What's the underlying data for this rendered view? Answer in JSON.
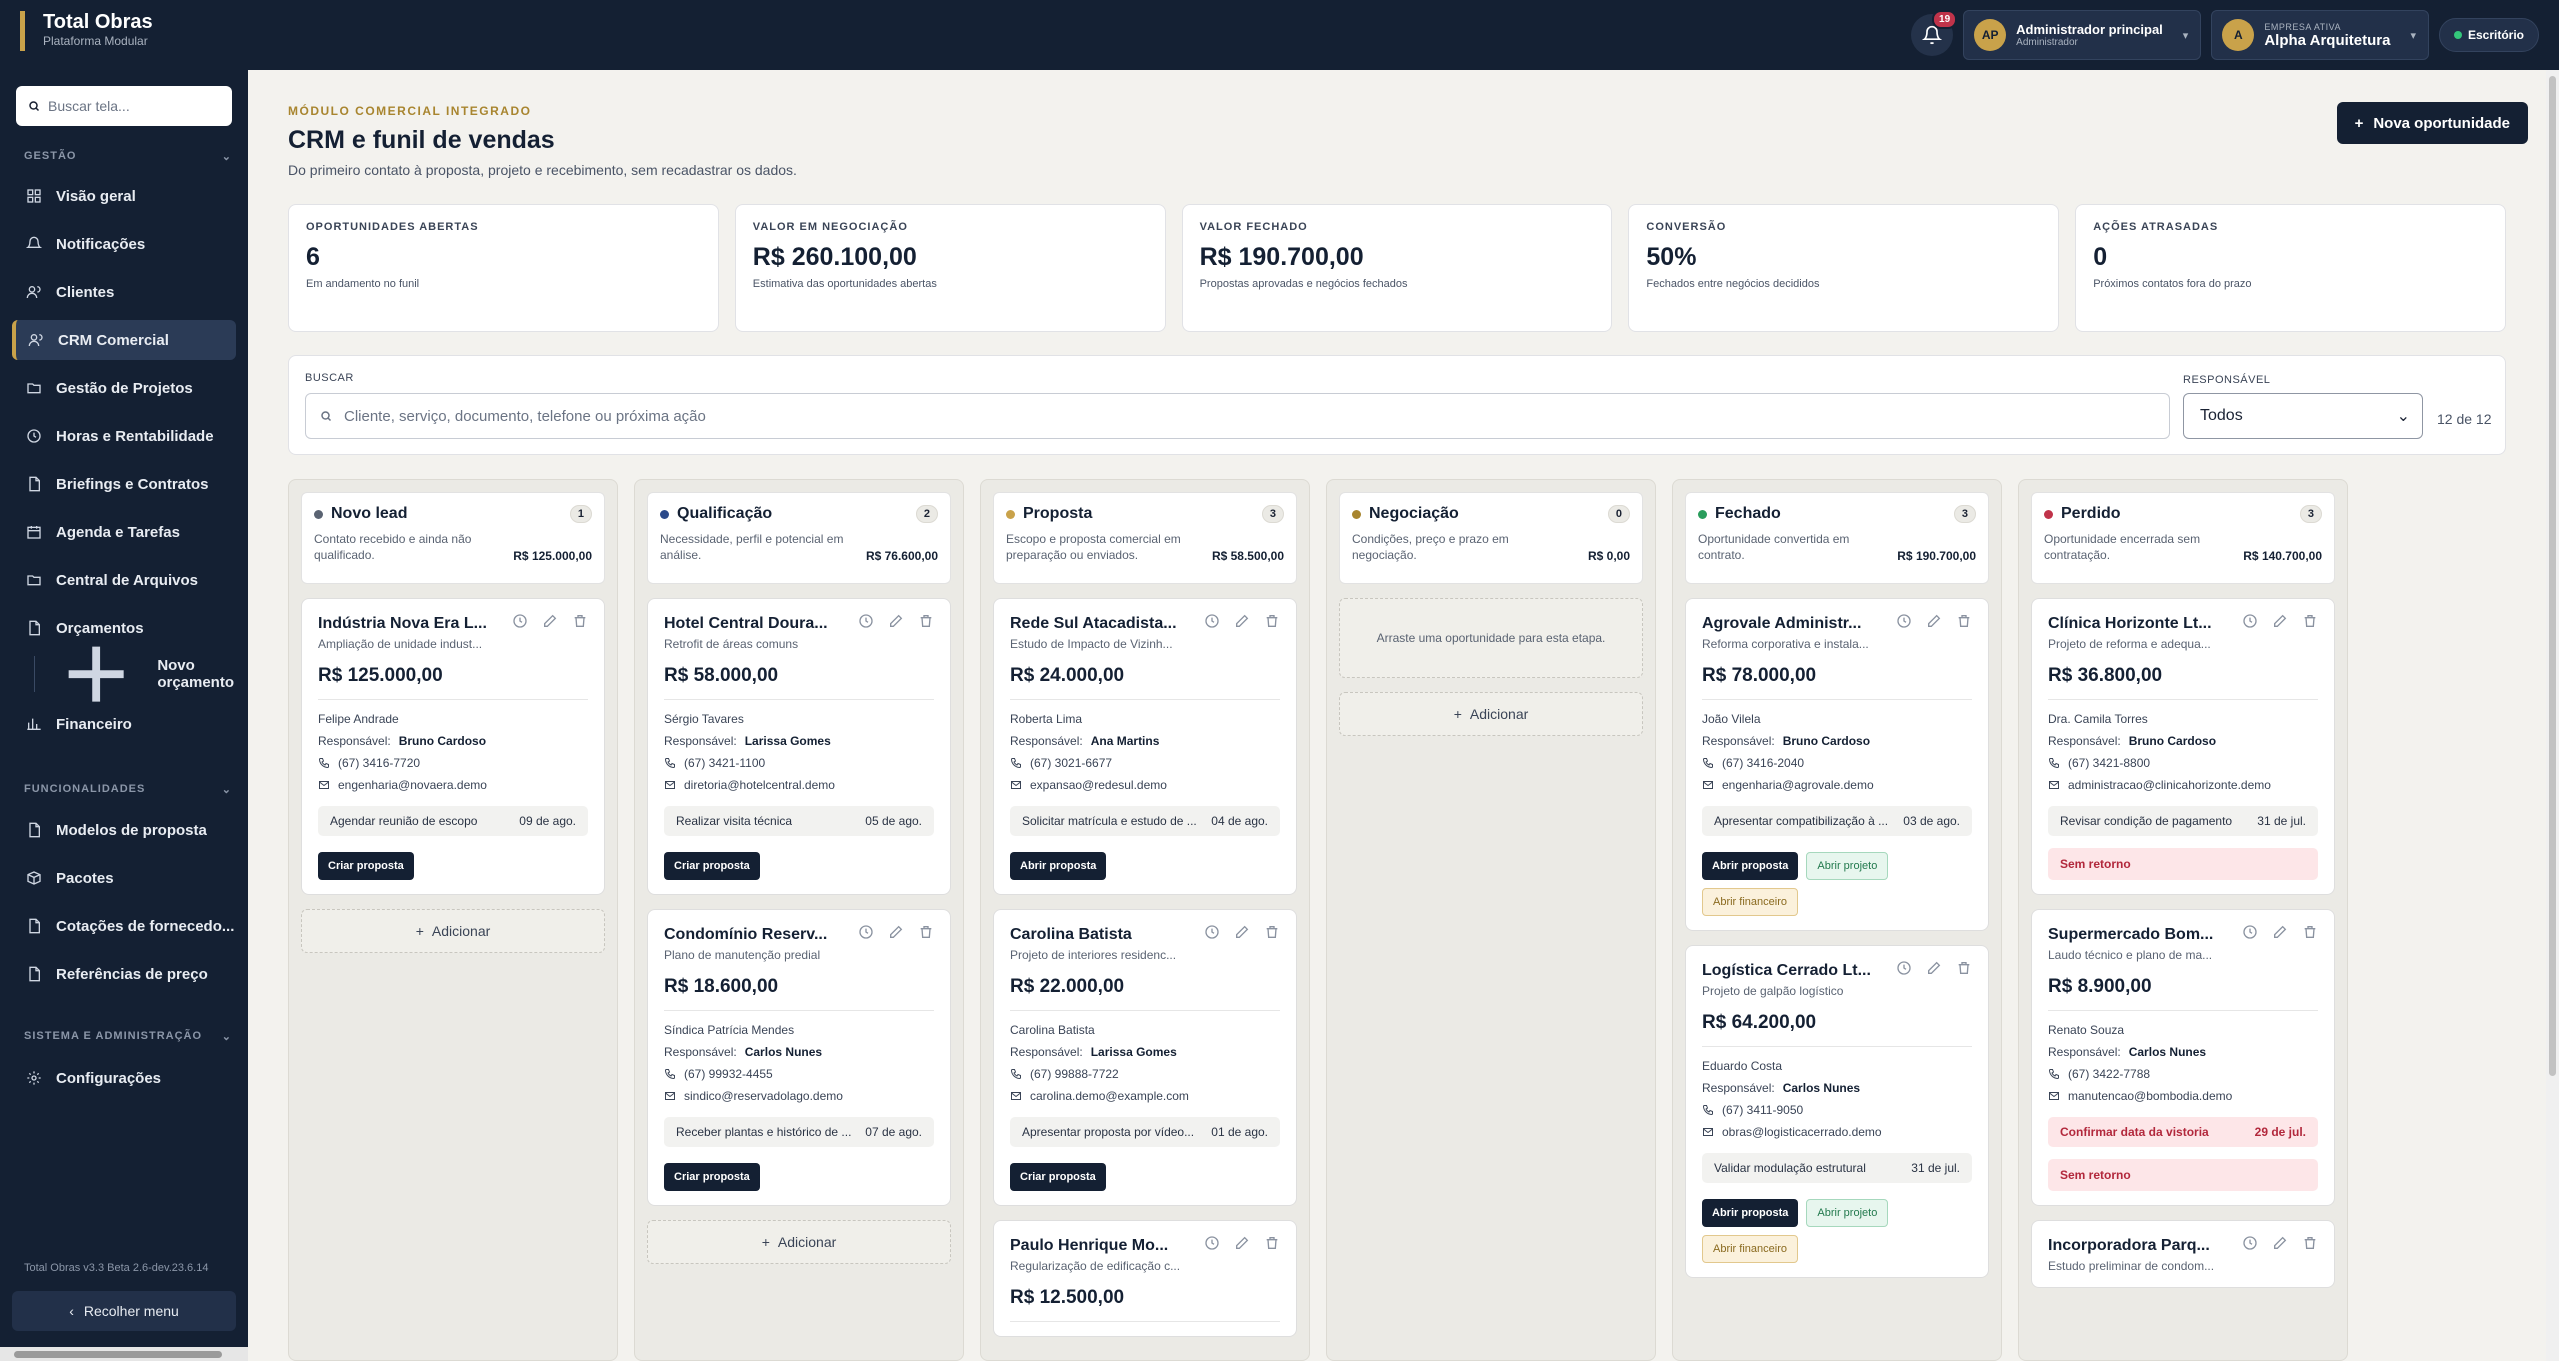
{
  "app": {
    "title": "Total Obras",
    "subtitle": "Plataforma Modular"
  },
  "topbar": {
    "notifications_count": "19",
    "user_initials": "AP",
    "user_name": "Administrador principal",
    "user_role": "Administrador",
    "company_label": "EMPRESA ATIVA",
    "company_initial": "A",
    "company_name": "Alpha Arquitetura",
    "office_label": "Escritório"
  },
  "sidebar": {
    "search_placeholder": "Buscar tela...",
    "section_gestao": "GESTÃO",
    "section_funcionalidades": "FUNCIONALIDADES",
    "section_sistema": "SISTEMA E ADMINISTRAÇÃO",
    "items": [
      {
        "label": "Visão geral",
        "icon": "grid-icon"
      },
      {
        "label": "Notificações",
        "icon": "bell-icon"
      },
      {
        "label": "Clientes",
        "icon": "users-icon"
      },
      {
        "label": "CRM Comercial",
        "icon": "users-icon"
      },
      {
        "label": "Gestão de Projetos",
        "icon": "folder-icon"
      },
      {
        "label": "Horas e Rentabilidade",
        "icon": "clock-icon"
      },
      {
        "label": "Briefings e Contratos",
        "icon": "file-icon"
      },
      {
        "label": "Agenda e Tarefas",
        "icon": "calendar-icon"
      },
      {
        "label": "Central de Arquivos",
        "icon": "folder-icon"
      },
      {
        "label": "Orçamentos",
        "icon": "file-icon"
      },
      {
        "label": "Novo orçamento",
        "icon": "plus-icon"
      },
      {
        "label": "Financeiro",
        "icon": "bar-chart-icon"
      }
    ],
    "func_items": [
      {
        "label": "Modelos de proposta",
        "icon": "file-icon"
      },
      {
        "label": "Pacotes",
        "icon": "box-icon"
      },
      {
        "label": "Cotações de fornecedo...",
        "icon": "file-icon"
      },
      {
        "label": "Referências de preço",
        "icon": "file-icon"
      }
    ],
    "sys_items": [
      {
        "label": "Configurações",
        "icon": "gear-icon"
      }
    ],
    "version": "Total Obras v3.3 Beta 2.6-dev.23.6.14",
    "collapse_label": "Recolher menu"
  },
  "page": {
    "eyebrow": "MÓDULO COMERCIAL INTEGRADO",
    "title": "CRM e funil de vendas",
    "subtitle": "Do primeiro contato à proposta, projeto e recebimento, sem recadastrar os dados.",
    "new_button": "Nova oportunidade"
  },
  "kpis": [
    {
      "label": "OPORTUNIDADES ABERTAS",
      "value": "6",
      "help": "Em andamento no funil"
    },
    {
      "label": "VALOR EM NEGOCIAÇÃO",
      "value": "R$ 260.100,00",
      "help": "Estimativa das oportunidades abertas"
    },
    {
      "label": "VALOR FECHADO",
      "value": "R$ 190.700,00",
      "help": "Propostas aprovadas e negócios fechados"
    },
    {
      "label": "CONVERSÃO",
      "value": "50%",
      "help": "Fechados entre negócios decididos"
    },
    {
      "label": "AÇÕES ATRASADAS",
      "value": "0",
      "help": "Próximos contatos fora do prazo"
    }
  ],
  "filters": {
    "search_label": "BUSCAR",
    "search_placeholder": "Cliente, serviço, documento, telefone ou próxima ação",
    "owner_label": "RESPONSÁVEL",
    "owner_value": "Todos",
    "count": "12 de 12"
  },
  "board": {
    "add_label": "Adicionar",
    "drop_hint": "Arraste uma oportunidade para esta etapa.",
    "responsible_prefix": "Responsável:",
    "columns": [
      {
        "title": "Novo lead",
        "count": "1",
        "color": "#5a6372",
        "desc": "Contato recebido e ainda não qualificado.",
        "total": "R$ 125.000,00",
        "cards": [
          {
            "title": "Indústria Nova Era L...",
            "service": "Ampliação de unidade indust...",
            "value": "R$ 125.000,00",
            "contact": "Felipe Andrade",
            "owner": "Bruno Cardoso",
            "phone": "(67) 3416-7720",
            "email": "engenharia@novaera.demo",
            "action": "Agendar reunião de escopo",
            "date": "09 de ago.",
            "buttons": [
              "Criar proposta"
            ]
          }
        ]
      },
      {
        "title": "Qualificação",
        "count": "2",
        "color": "#2c4a8a",
        "desc": "Necessidade, perfil e potencial em análise.",
        "total": "R$ 76.600,00",
        "cards": [
          {
            "title": "Hotel Central Doura...",
            "service": "Retrofit de áreas comuns",
            "value": "R$ 58.000,00",
            "contact": "Sérgio Tavares",
            "owner": "Larissa Gomes",
            "phone": "(67) 3421-1100",
            "email": "diretoria@hotelcentral.demo",
            "action": "Realizar visita técnica",
            "date": "05 de ago.",
            "buttons": [
              "Criar proposta"
            ]
          },
          {
            "title": "Condomínio Reserv...",
            "service": "Plano de manutenção predial",
            "value": "R$ 18.600,00",
            "contact": "Síndica Patrícia Mendes",
            "owner": "Carlos Nunes",
            "phone": "(67) 99932-4455",
            "email": "sindico@reservadolago.demo",
            "action": "Receber plantas e histórico de ...",
            "date": "07 de ago.",
            "buttons": [
              "Criar proposta"
            ]
          }
        ]
      },
      {
        "title": "Proposta",
        "count": "3",
        "color": "#c9a24a",
        "desc": "Escopo e proposta comercial em preparação ou enviados.",
        "total": "R$ 58.500,00",
        "cards": [
          {
            "title": "Rede Sul Atacadista...",
            "service": "Estudo de Impacto de Vizinh...",
            "value": "R$ 24.000,00",
            "contact": "Roberta Lima",
            "owner": "Ana Martins",
            "phone": "(67) 3021-6677",
            "email": "expansao@redesul.demo",
            "action": "Solicitar matrícula e estudo de ...",
            "date": "04 de ago.",
            "buttons": [
              "Abrir proposta"
            ]
          },
          {
            "title": "Carolina Batista",
            "service": "Projeto de interiores residenc...",
            "value": "R$ 22.000,00",
            "contact": "Carolina Batista",
            "owner": "Larissa Gomes",
            "phone": "(67) 99888-7722",
            "email": "carolina.demo@example.com",
            "action": "Apresentar proposta por vídeo...",
            "date": "01 de ago.",
            "buttons": [
              "Criar proposta"
            ]
          },
          {
            "title": "Paulo Henrique Mo...",
            "service": "Regularização de edificação c...",
            "value": "R$ 12.500,00"
          }
        ]
      },
      {
        "title": "Negociação",
        "count": "0",
        "color": "#a8852f",
        "desc": "Condições, preço e prazo em negociação.",
        "total": "R$ 0,00",
        "cards": []
      },
      {
        "title": "Fechado",
        "count": "3",
        "color": "#2a9d5c",
        "desc": "Oportunidade convertida em contrato.",
        "total": "R$ 190.700,00",
        "cards": [
          {
            "title": "Agrovale Administr...",
            "service": "Reforma corporativa e instala...",
            "value": "R$ 78.000,00",
            "contact": "João Vilela",
            "owner": "Bruno Cardoso",
            "phone": "(67) 3416-2040",
            "email": "engenharia@agrovale.demo",
            "action": "Apresentar compatibilização à ...",
            "date": "03 de ago.",
            "buttons": [
              "Abrir proposta",
              "Abrir projeto",
              "Abrir financeiro"
            ]
          },
          {
            "title": "Logística Cerrado Lt...",
            "service": "Projeto de galpão logístico",
            "value": "R$ 64.200,00",
            "contact": "Eduardo Costa",
            "owner": "Carlos Nunes",
            "phone": "(67) 3411-9050",
            "email": "obras@logisticacerrado.demo",
            "action": "Validar modulação estrutural",
            "date": "31 de jul.",
            "buttons": [
              "Abrir proposta",
              "Abrir projeto",
              "Abrir financeiro"
            ]
          }
        ]
      },
      {
        "title": "Perdido",
        "count": "3",
        "color": "#c0334a",
        "desc": "Oportunidade encerrada sem contratação.",
        "total": "R$ 140.700,00",
        "cards": [
          {
            "title": "Clínica Horizonte Lt...",
            "service": "Projeto de reforma e adequa...",
            "value": "R$ 36.800,00",
            "contact": "Dra. Camila Torres",
            "owner": "Bruno Cardoso",
            "phone": "(67) 3421-8800",
            "email": "administracao@clinicahorizonte.demo",
            "action": "Revisar condição de pagamento",
            "date": "31 de jul.",
            "lost": "Sem retorno"
          },
          {
            "title": "Supermercado Bom...",
            "service": "Laudo técnico e plano de ma...",
            "value": "R$ 8.900,00",
            "contact": "Renato Souza",
            "owner": "Carlos Nunes",
            "phone": "(67) 3422-7788",
            "email": "manutencao@bombodia.demo",
            "action": "Confirmar data da vistoria",
            "date": "29 de jul.",
            "action_warn": true,
            "lost": "Sem retorno"
          },
          {
            "title": "Incorporadora Parq...",
            "service": "Estudo preliminar de condom..."
          }
        ]
      }
    ]
  }
}
